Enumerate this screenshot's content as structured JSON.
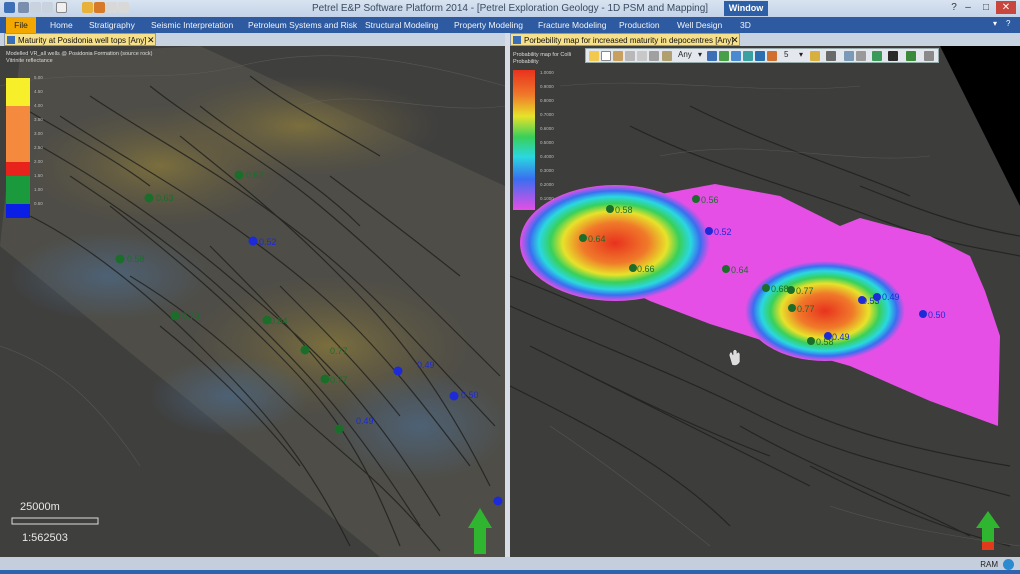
{
  "window": {
    "title": "Petrel E&P Software Platform 2014 - [Petrel Exploration Geology - 1D PSM and Mapping]",
    "window_tab": "Window",
    "minimize": "–",
    "restore": "□",
    "close": "✕"
  },
  "menu": {
    "items": [
      "File",
      "Home",
      "Stratigraphy",
      "Seismic Interpretation",
      "Petroleum Systems and Risk",
      "Structural Modeling",
      "Property Modeling",
      "Fracture Modeling",
      "Production",
      "Well Design",
      "3D"
    ],
    "help_icon": "?"
  },
  "left_panel": {
    "tab_label": "Maturity at Posidonia well tops [Any]",
    "legend_title": "Modelled VR_all wells @ Posidonia Formation (source rock)",
    "legend_subtitle": "Vitrinite reflectance",
    "legend_ticks": [
      "5.00",
      "4.50",
      "4.00",
      "3.50",
      "3.00",
      "2.50",
      "2.00",
      "1.50",
      "1.00",
      "0.50"
    ],
    "legend_colors": [
      "#f7ef2a",
      "#f7ef2a",
      "#f48a3e",
      "#f48a3e",
      "#f48a3e",
      "#f48a3e",
      "#e8231c",
      "#1a9a3c",
      "#1a9a3c",
      "#0a1ee6"
    ],
    "scale_text": "25000m",
    "ratio_text": "1:562503",
    "wells": [
      {
        "label": "0.62",
        "color": "#1a6e2a"
      },
      {
        "label": "0.52",
        "color": "#1c2ad8"
      },
      {
        "label": "0.63",
        "color": "#1a6e2a"
      },
      {
        "label": "0.58",
        "color": "#1a6e2a"
      },
      {
        "label": "0.84",
        "color": "#1a6e2a"
      },
      {
        "label": "0.73",
        "color": "#1a6e2a"
      },
      {
        "label": "0.77",
        "color": "#1a6e2a"
      },
      {
        "label": "0.77",
        "color": "#1a6e2a"
      },
      {
        "label": "0.49",
        "color": "#1c2ad8"
      },
      {
        "label": "0.50",
        "color": "#1c2ad8"
      },
      {
        "label": "0.49",
        "color": "#1c2ad8"
      }
    ]
  },
  "right_panel": {
    "tab_label": "Porbebility map for increased maturity in depocentres [Any]",
    "legend_title": "Probability map for Colli",
    "legend_subtitle": "Probability",
    "legend_ticks": [
      "1.0000",
      "0.9000",
      "0.8000",
      "0.7000",
      "0.6000",
      "0.5000",
      "0.4000",
      "0.3000",
      "0.2000",
      "0.1000"
    ],
    "wells": [
      {
        "label": "0.58",
        "color": "#1a6e2a"
      },
      {
        "label": "0.64",
        "color": "#1a6e2a"
      },
      {
        "label": "0.66",
        "color": "#1a6e2a"
      },
      {
        "label": "0.56",
        "color": "#1a6e2a"
      },
      {
        "label": "0.52",
        "color": "#1c2ad8"
      },
      {
        "label": "0.64",
        "color": "#1a6e2a"
      },
      {
        "label": "0.68",
        "color": "#1a6e2a"
      },
      {
        "label": "0.77",
        "color": "#1a6e2a"
      },
      {
        "label": "0.77",
        "color": "#1a6e2a"
      },
      {
        "label": "0.53",
        "color": "#1c2ad8"
      },
      {
        "label": "0.49",
        "color": "#1c2ad8"
      },
      {
        "label": "0.50",
        "color": "#1c2ad8"
      },
      {
        "label": "0.49",
        "color": "#1c2ad8"
      },
      {
        "label": "0.58",
        "color": "#1a6e2a"
      }
    ]
  },
  "toolbar": {
    "filter_value": "Any",
    "count_value": "5"
  },
  "statusbar": {
    "ram_label": "RAM"
  },
  "icons": {
    "north_arrow": "north-arrow-icon",
    "hand_cursor": "hand-cursor-icon"
  },
  "colors": {
    "menubar": "#2d5aa0",
    "file_tab": "#f2a800",
    "active_tab": "#f6e08a",
    "well_green": "#1a6e2a",
    "well_blue": "#1c2ad8"
  }
}
